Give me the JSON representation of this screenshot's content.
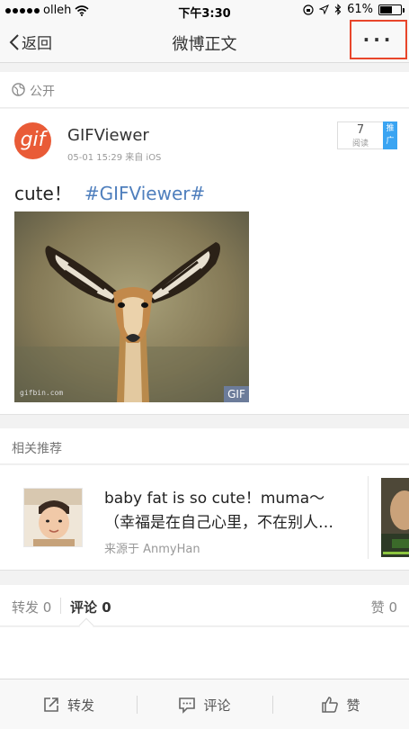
{
  "status_bar": {
    "carrier": "olleh",
    "time": "下午3:30",
    "battery": "61%",
    "battery_level": 0.61
  },
  "nav": {
    "back_label": "返回",
    "title": "微博正文",
    "more_label": "···"
  },
  "visibility": {
    "label": "公开"
  },
  "post": {
    "avatar_text": "gif",
    "author": "GIFViewer",
    "meta": "05-01 15:29  来自 iOS",
    "reads_count": "7",
    "reads_label": "阅读",
    "promo_label": "推广",
    "text": "cute！",
    "hashtag": "#GIFViewer#",
    "gif_badge": "GIF",
    "watermark": "gifbin.com"
  },
  "recommend": {
    "header": "相关推荐",
    "card": {
      "line1": "baby fat is so cute！muma～",
      "line2": "（幸福是在自己心里，不在别人…",
      "source": "来源于 AnmyHan"
    }
  },
  "tabs": {
    "repost": "转发 0",
    "comment": "评论 0",
    "like": "赞 0"
  },
  "toolbar": {
    "repost": "转发",
    "comment": "评论",
    "like": "赞"
  },
  "colors": {
    "accent_link": "#4f7fbd",
    "highlight_box": "#e8452a",
    "promo_badge": "#3aa4f2",
    "gif_avatar": "#e95b37"
  }
}
